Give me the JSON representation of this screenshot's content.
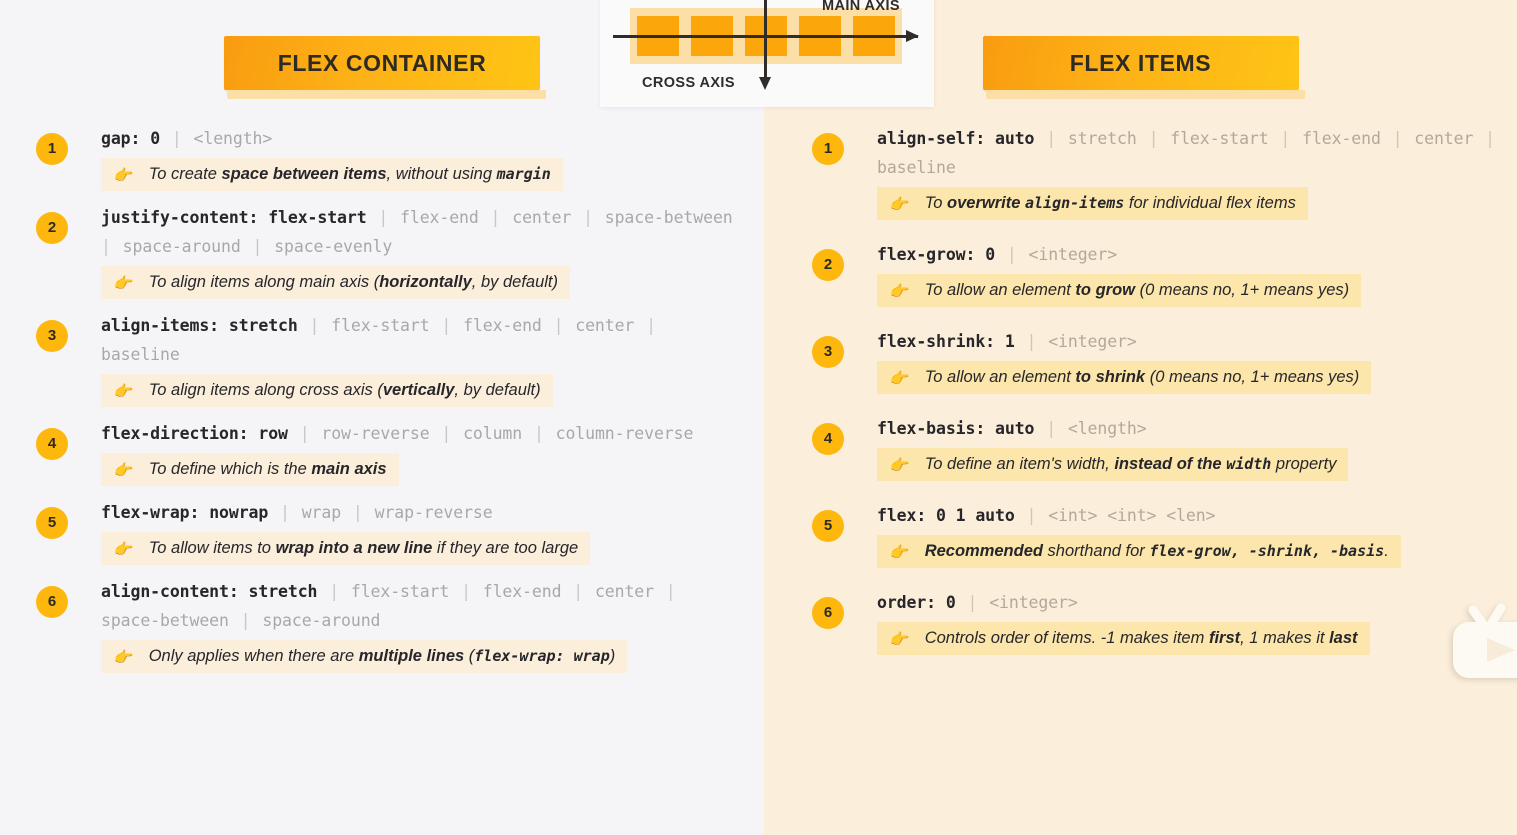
{
  "diagram": {
    "main_axis_label": "MAIN AXIS",
    "cross_axis_label": "CROSS AXIS",
    "item_count": 5
  },
  "left": {
    "title": "FLEX CONTAINER",
    "items": [
      {
        "num": "1",
        "prop": "gap:",
        "value": "0",
        "alts": [
          "<length>"
        ],
        "hint_pre": "To create ",
        "hint_bold": "space between items",
        "hint_mid": ", without using ",
        "hint_code": "margin",
        "hint_post": ""
      },
      {
        "num": "2",
        "prop": "justify-content:",
        "value": "flex-start",
        "alts": [
          "flex-end",
          "center",
          "space-between",
          "space-around",
          "space-evenly"
        ],
        "hint_pre": "To align items along main axis (",
        "hint_bold": "horizontally",
        "hint_mid": ", by default)",
        "hint_code": "",
        "hint_post": ""
      },
      {
        "num": "3",
        "prop": "align-items:",
        "value": "stretch",
        "alts": [
          "flex-start",
          "flex-end",
          "center",
          "baseline"
        ],
        "hint_pre": "To align items along cross axis (",
        "hint_bold": "vertically",
        "hint_mid": ", by default)",
        "hint_code": "",
        "hint_post": ""
      },
      {
        "num": "4",
        "prop": "flex-direction:",
        "value": "row",
        "alts": [
          "row-reverse",
          "column",
          "column-reverse"
        ],
        "hint_pre": "To define which is the ",
        "hint_bold": "main axis",
        "hint_mid": "",
        "hint_code": "",
        "hint_post": ""
      },
      {
        "num": "5",
        "prop": "flex-wrap:",
        "value": "nowrap",
        "alts": [
          "wrap",
          "wrap-reverse"
        ],
        "hint_pre": "To allow items to ",
        "hint_bold": "wrap into a new line",
        "hint_mid": " if they are too large",
        "hint_code": "",
        "hint_post": ""
      },
      {
        "num": "6",
        "prop": "align-content:",
        "value": "stretch",
        "alts": [
          "flex-start",
          "flex-end",
          "center",
          "space-between",
          "space-around"
        ],
        "hint_pre": "Only applies when there are ",
        "hint_bold": "multiple lines",
        "hint_mid": " (",
        "hint_code": "flex-wrap: wrap",
        "hint_post": ")"
      }
    ]
  },
  "right": {
    "title": "FLEX ITEMS",
    "items": [
      {
        "num": "1",
        "prop": "align-self:",
        "value": "auto",
        "alts": [
          "stretch",
          "flex-start",
          "flex-end",
          "center",
          "baseline"
        ],
        "hint_pre": "To ",
        "hint_bold": "overwrite",
        "hint_mid": " ",
        "hint_code": "align-items",
        "hint_post": " for individual flex items"
      },
      {
        "num": "2",
        "prop": "flex-grow:",
        "value": "0",
        "alts": [
          "<integer>"
        ],
        "hint_pre": "To allow an element ",
        "hint_bold": "to grow",
        "hint_mid": " (0 means no, 1+ means yes)",
        "hint_code": "",
        "hint_post": ""
      },
      {
        "num": "3",
        "prop": "flex-shrink:",
        "value": "1",
        "alts": [
          "<integer>"
        ],
        "hint_pre": "To allow an element ",
        "hint_bold": "to shrink",
        "hint_mid": " (0 means no, 1+ means yes)",
        "hint_code": "",
        "hint_post": ""
      },
      {
        "num": "4",
        "prop": "flex-basis:",
        "value": "auto",
        "alts": [
          "<length>"
        ],
        "hint_pre": "To define an item's width, ",
        "hint_bold": "instead of the ",
        "hint_mid": "",
        "hint_code": "width",
        "hint_post": " property"
      },
      {
        "num": "5",
        "prop": "flex:",
        "value": "0 1 auto",
        "alts": [
          "<int> <int> <len>"
        ],
        "hint_pre": "",
        "hint_bold": "Recommended",
        "hint_mid": " shorthand for ",
        "hint_code": "flex-grow, -shrink, -basis",
        "hint_post": "."
      },
      {
        "num": "6",
        "prop": "order:",
        "value": "0",
        "alts": [
          "<integer>"
        ],
        "hint_pre": "Controls order of items. -1 makes item ",
        "hint_bold": "first",
        "hint_mid": ", 1 makes it ",
        "hint_code": "",
        "hint_post": "last"
      }
    ]
  },
  "overlay": {
    "icon": "tv-play-icon"
  },
  "colors": {
    "accent_orange": "#feb70d",
    "left_bg": "#f5f4f7",
    "right_bg": "#fbeeda",
    "hint_left_bg": "#fbeeda",
    "hint_right_bg": "#fce6ab"
  }
}
